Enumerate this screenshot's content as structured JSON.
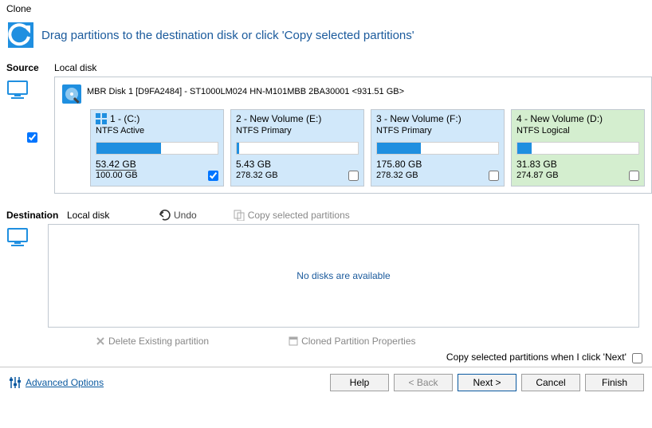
{
  "window_title": "Clone",
  "header_text": "Drag partitions to the destination disk or click 'Copy selected partitions'",
  "source": {
    "label": "Source",
    "sub": "Local disk"
  },
  "disk": {
    "title": "MBR Disk 1 [D9FA2484] - ST1000LM024 HN-M101MBB 2BA30001  <931.51 GB>"
  },
  "partitions": [
    {
      "name": "1 -  (C:)",
      "type": "NTFS Active",
      "used": "53.42 GB",
      "total": "100.00 GB",
      "fill": 53,
      "checked": true,
      "os": true,
      "theme": "blue"
    },
    {
      "name": "2 - New Volume (E:)",
      "type": "NTFS Primary",
      "used": "5.43 GB",
      "total": "278.32 GB",
      "fill": 2,
      "checked": false,
      "os": false,
      "theme": "blue"
    },
    {
      "name": "3 - New Volume (F:)",
      "type": "NTFS Primary",
      "used": "175.80 GB",
      "total": "278.32 GB",
      "fill": 36,
      "checked": false,
      "os": false,
      "theme": "blue"
    },
    {
      "name": "4 - New Volume (D:)",
      "type": "NTFS Logical",
      "used": "31.83 GB",
      "total": "274.87 GB",
      "fill": 12,
      "checked": false,
      "os": false,
      "theme": "green"
    }
  ],
  "destination": {
    "label": "Destination",
    "sub": "Local disk"
  },
  "actions": {
    "undo": "Undo",
    "copy": "Copy selected partitions",
    "delete": "Delete Existing partition",
    "props": "Cloned Partition Properties"
  },
  "dest_empty": "No disks are available",
  "hint": "Copy selected partitions when I click 'Next'",
  "advanced": "Advanced Options",
  "buttons": {
    "help": "Help",
    "back": "< Back",
    "next": "Next >",
    "cancel": "Cancel",
    "finish": "Finish"
  }
}
